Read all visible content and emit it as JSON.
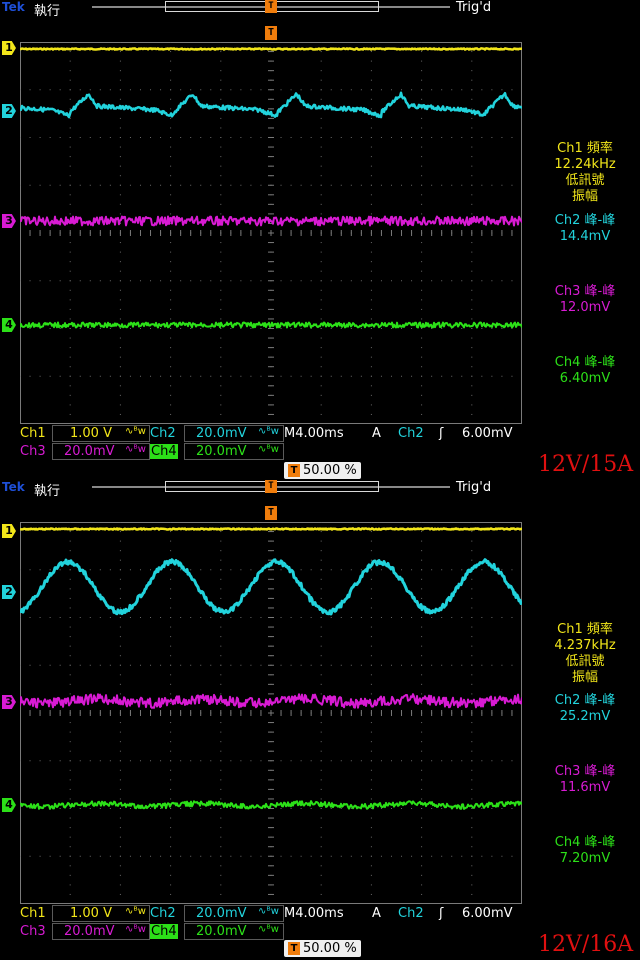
{
  "colors": {
    "ch1": "#f2e61a",
    "ch2": "#22d3dc",
    "ch3": "#d81bd3",
    "ch4": "#2ce018",
    "trigger": "#f07d0c",
    "brand": "#1e4fd6",
    "caption": "#e01010"
  },
  "panels": [
    {
      "brand": "Tek",
      "state": "執行",
      "trig_status": "Trig'd",
      "trig_marker": "T",
      "channel_markers": [
        "1",
        "2",
        "3",
        "4"
      ],
      "meas": [
        {
          "lines": [
            "Ch1 頻率",
            "12.24kHz",
            "低訊號",
            "振幅"
          ],
          "color_key": "ch1"
        },
        {
          "lines": [
            "Ch2 峰-峰",
            "14.4mV"
          ],
          "color_key": "ch2"
        },
        {
          "lines": [
            "Ch3 峰-峰",
            "12.0mV"
          ],
          "color_key": "ch3"
        },
        {
          "lines": [
            "Ch4 峰-峰",
            "6.40mV"
          ],
          "color_key": "ch4"
        }
      ],
      "bottom": {
        "ch1_label": "Ch1",
        "ch1_scale": "1.00 V",
        "bw1": "∿ᴮw",
        "ch2_label": "Ch2",
        "ch2_scale": "20.0mV",
        "bw2": "∿ᴮw",
        "timebase": "M4.00ms",
        "coupling": "A",
        "trig_src": "Ch2",
        "trig_slope": "ʃ",
        "trig_level": "6.00mV",
        "ch3_label": "Ch3",
        "ch3_scale": "20.0mV",
        "bw3": "∿ᴮw",
        "ch4_label": "Ch4",
        "ch4_scale": "20.0mV",
        "bw4": "∿ᴮw",
        "trig_badge": "T",
        "trig_pos": "50.00 %"
      },
      "caption": "12V/15A",
      "ch2_wave": "sawtooth"
    },
    {
      "brand": "Tek",
      "state": "執行",
      "trig_status": "Trig'd",
      "trig_marker": "T",
      "channel_markers": [
        "1",
        "2",
        "3",
        "4"
      ],
      "meas": [
        {
          "lines": [
            "Ch1 頻率",
            "4.237kHz",
            "低訊號",
            "振幅"
          ],
          "color_key": "ch1"
        },
        {
          "lines": [
            "Ch2 峰-峰",
            "25.2mV"
          ],
          "color_key": "ch2"
        },
        {
          "lines": [
            "Ch3 峰-峰",
            "11.6mV"
          ],
          "color_key": "ch3"
        },
        {
          "lines": [
            "Ch4 峰-峰",
            "7.20mV"
          ],
          "color_key": "ch4"
        }
      ],
      "bottom": {
        "ch1_label": "Ch1",
        "ch1_scale": "1.00 V",
        "bw1": "∿ᴮw",
        "ch2_label": "Ch2",
        "ch2_scale": "20.0mV",
        "bw2": "∿ᴮw",
        "timebase": "M4.00ms",
        "coupling": "A",
        "trig_src": "Ch2",
        "trig_slope": "ʃ",
        "trig_level": "6.00mV",
        "ch3_label": "Ch3",
        "ch3_scale": "20.0mV",
        "bw3": "∿ᴮw",
        "ch4_label": "Ch4",
        "ch4_scale": "20.0mV",
        "bw4": "∿ᴮw",
        "trig_badge": "T",
        "trig_pos": "50.00 %"
      },
      "caption": "12V/16A",
      "ch2_wave": "sine"
    }
  ]
}
